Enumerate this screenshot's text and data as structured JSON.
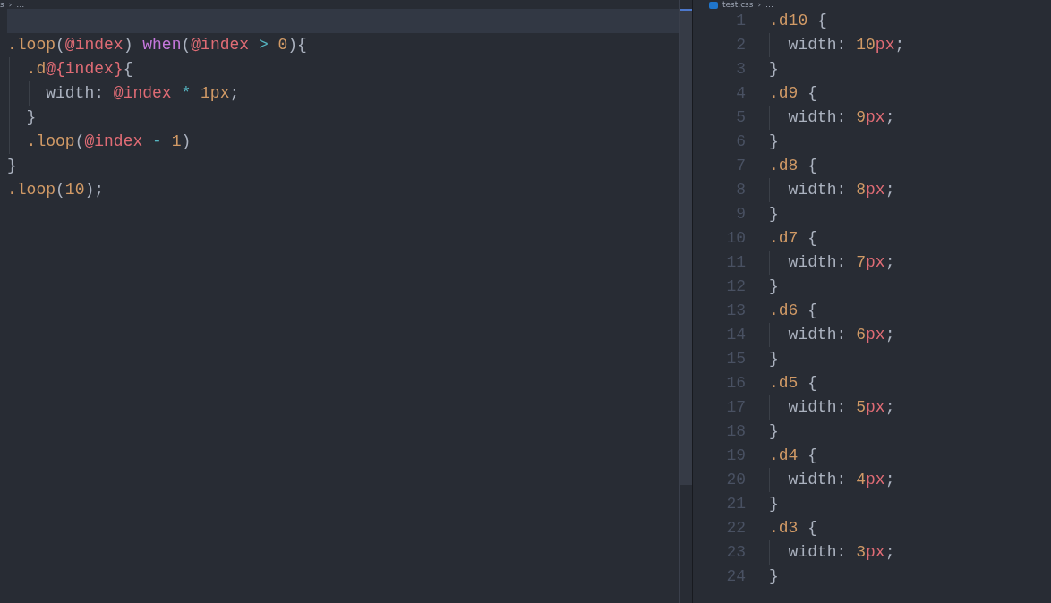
{
  "left_editor": {
    "breadcrumb": {
      "file": "s",
      "separator": "›",
      "rest": "…"
    },
    "lines": [
      {
        "current": true
      },
      {
        "current": false,
        "tokens": [
          {
            "kind": "selector",
            "text": ".loop"
          },
          {
            "kind": "punct",
            "text": "("
          },
          {
            "kind": "variable",
            "text": "@index"
          },
          {
            "kind": "punct",
            "text": ") "
          },
          {
            "kind": "keyword",
            "text": "when"
          },
          {
            "kind": "punct",
            "text": "("
          },
          {
            "kind": "variable",
            "text": "@index"
          },
          {
            "kind": "operator",
            "text": " > "
          },
          {
            "kind": "number",
            "text": "0"
          },
          {
            "kind": "punct",
            "text": "){"
          }
        ]
      },
      {
        "current": false,
        "tokens": [
          {
            "kind": "selector",
            "text": "  .d"
          },
          {
            "kind": "variable",
            "text": "@{index}"
          },
          {
            "kind": "punct",
            "text": "{"
          }
        ]
      },
      {
        "current": false,
        "tokens": [
          {
            "kind": "punct",
            "text": "    width: "
          },
          {
            "kind": "variable",
            "text": "@index"
          },
          {
            "kind": "operator",
            "text": " * "
          },
          {
            "kind": "number",
            "text": "1"
          },
          {
            "kind": "number",
            "text": "px"
          },
          {
            "kind": "punct",
            "text": ";"
          }
        ]
      },
      {
        "current": false,
        "tokens": [
          {
            "kind": "punct",
            "text": "  }"
          }
        ]
      },
      {
        "current": false,
        "tokens": [
          {
            "kind": "selector",
            "text": "  .loop"
          },
          {
            "kind": "punct",
            "text": "("
          },
          {
            "kind": "variable",
            "text": "@index"
          },
          {
            "kind": "operator",
            "text": " - "
          },
          {
            "kind": "number",
            "text": "1"
          },
          {
            "kind": "punct",
            "text": ")"
          }
        ]
      },
      {
        "current": false,
        "tokens": [
          {
            "kind": "punct",
            "text": "}"
          }
        ]
      },
      {
        "current": false,
        "tokens": [
          {
            "kind": "selector",
            "text": ".loop"
          },
          {
            "kind": "punct",
            "text": "("
          },
          {
            "kind": "number",
            "text": "10"
          },
          {
            "kind": "punct",
            "text": ");"
          }
        ]
      }
    ]
  },
  "right_editor": {
    "breadcrumb": {
      "file": "test.css",
      "separator": "›",
      "rest": "…"
    },
    "lines": [
      {
        "number": "1",
        "tokens": [
          {
            "kind": "selector",
            "text": ".d10"
          },
          {
            "kind": "punct",
            "text": " {"
          }
        ]
      },
      {
        "number": "2",
        "tokens": [
          {
            "kind": "punct",
            "text": "  width: "
          },
          {
            "kind": "number",
            "text": "10"
          },
          {
            "kind": "unit",
            "text": "px"
          },
          {
            "kind": "punct",
            "text": ";"
          }
        ]
      },
      {
        "number": "3",
        "tokens": [
          {
            "kind": "punct",
            "text": "}"
          }
        ]
      },
      {
        "number": "4",
        "tokens": [
          {
            "kind": "selector",
            "text": ".d9"
          },
          {
            "kind": "punct",
            "text": " {"
          }
        ]
      },
      {
        "number": "5",
        "tokens": [
          {
            "kind": "punct",
            "text": "  width: "
          },
          {
            "kind": "number",
            "text": "9"
          },
          {
            "kind": "unit",
            "text": "px"
          },
          {
            "kind": "punct",
            "text": ";"
          }
        ]
      },
      {
        "number": "6",
        "tokens": [
          {
            "kind": "punct",
            "text": "}"
          }
        ]
      },
      {
        "number": "7",
        "tokens": [
          {
            "kind": "selector",
            "text": ".d8"
          },
          {
            "kind": "punct",
            "text": " {"
          }
        ]
      },
      {
        "number": "8",
        "tokens": [
          {
            "kind": "punct",
            "text": "  width: "
          },
          {
            "kind": "number",
            "text": "8"
          },
          {
            "kind": "unit",
            "text": "px"
          },
          {
            "kind": "punct",
            "text": ";"
          }
        ]
      },
      {
        "number": "9",
        "tokens": [
          {
            "kind": "punct",
            "text": "}"
          }
        ]
      },
      {
        "number": "10",
        "tokens": [
          {
            "kind": "selector",
            "text": ".d7"
          },
          {
            "kind": "punct",
            "text": " {"
          }
        ]
      },
      {
        "number": "11",
        "tokens": [
          {
            "kind": "punct",
            "text": "  width: "
          },
          {
            "kind": "number",
            "text": "7"
          },
          {
            "kind": "unit",
            "text": "px"
          },
          {
            "kind": "punct",
            "text": ";"
          }
        ]
      },
      {
        "number": "12",
        "tokens": [
          {
            "kind": "punct",
            "text": "}"
          }
        ]
      },
      {
        "number": "13",
        "tokens": [
          {
            "kind": "selector",
            "text": ".d6"
          },
          {
            "kind": "punct",
            "text": " {"
          }
        ]
      },
      {
        "number": "14",
        "tokens": [
          {
            "kind": "punct",
            "text": "  width: "
          },
          {
            "kind": "number",
            "text": "6"
          },
          {
            "kind": "unit",
            "text": "px"
          },
          {
            "kind": "punct",
            "text": ";"
          }
        ]
      },
      {
        "number": "15",
        "tokens": [
          {
            "kind": "punct",
            "text": "}"
          }
        ]
      },
      {
        "number": "16",
        "tokens": [
          {
            "kind": "selector",
            "text": ".d5"
          },
          {
            "kind": "punct",
            "text": " {"
          }
        ]
      },
      {
        "number": "17",
        "tokens": [
          {
            "kind": "punct",
            "text": "  width: "
          },
          {
            "kind": "number",
            "text": "5"
          },
          {
            "kind": "unit",
            "text": "px"
          },
          {
            "kind": "punct",
            "text": ";"
          }
        ]
      },
      {
        "number": "18",
        "tokens": [
          {
            "kind": "punct",
            "text": "}"
          }
        ]
      },
      {
        "number": "19",
        "tokens": [
          {
            "kind": "selector",
            "text": ".d4"
          },
          {
            "kind": "punct",
            "text": " {"
          }
        ]
      },
      {
        "number": "20",
        "tokens": [
          {
            "kind": "punct",
            "text": "  width: "
          },
          {
            "kind": "number",
            "text": "4"
          },
          {
            "kind": "unit",
            "text": "px"
          },
          {
            "kind": "punct",
            "text": ";"
          }
        ]
      },
      {
        "number": "21",
        "tokens": [
          {
            "kind": "punct",
            "text": "}"
          }
        ]
      },
      {
        "number": "22",
        "tokens": [
          {
            "kind": "selector",
            "text": ".d3"
          },
          {
            "kind": "punct",
            "text": " {"
          }
        ]
      },
      {
        "number": "23",
        "tokens": [
          {
            "kind": "punct",
            "text": "  width: "
          },
          {
            "kind": "number",
            "text": "3"
          },
          {
            "kind": "unit",
            "text": "px"
          },
          {
            "kind": "punct",
            "text": ";"
          }
        ]
      },
      {
        "number": "24",
        "tokens": [
          {
            "kind": "punct",
            "text": "}"
          }
        ]
      }
    ]
  }
}
